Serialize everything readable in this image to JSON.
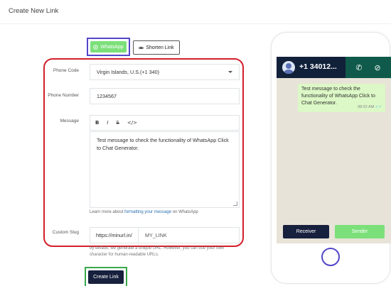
{
  "page": {
    "title": "Create New Link"
  },
  "mode": {
    "whatsapp_label": "WhatsApp",
    "shorten_label": "Shorten Link"
  },
  "form": {
    "phone_code_label": "Phone Code",
    "phone_code_value": "Virgin Islands, U.S.(+1 340)",
    "phone_number_label": "Phone Number",
    "phone_number_value": "1234567",
    "message_label": "Message",
    "toolbar": {
      "bold": "B",
      "italic": "I",
      "strike": "S",
      "code": "</>"
    },
    "message_value": "Test message to check the functionality of WhatsApp Click to Chat Generator.",
    "help_prefix": "Learn more about ",
    "help_link": "formatting your message",
    "help_suffix": " on WhatsApp",
    "slug_label": "Custom Slug",
    "slug_prefix": "https://minurl.in/",
    "slug_value": "MY_LINK",
    "slug_help": "by default, we generate a unique URL. However, you can use your own character for human-readable URLs.",
    "create_label": "Create Link"
  },
  "preview": {
    "number": "+1 34012...",
    "message": "Test message to check the functionality of WhatsApp Click to Chat Generator.",
    "time": "08:22 AM",
    "receiver_label": "Receiver",
    "sender_label": "Sender"
  },
  "colors": {
    "accent_green": "#7ce07a",
    "navy": "#17203d",
    "highlight_red": "#d21f2a",
    "highlight_purple": "#5247c9",
    "highlight_green": "#3aa84a"
  }
}
